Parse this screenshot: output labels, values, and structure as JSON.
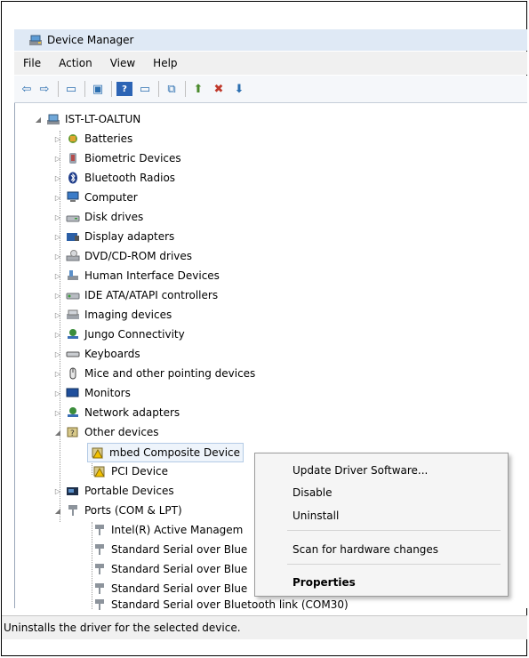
{
  "window": {
    "title": "Device Manager",
    "icon": "computer-management-icon"
  },
  "menu": {
    "items": [
      "File",
      "Action",
      "View",
      "Help"
    ]
  },
  "toolbar": {
    "buttons": [
      "back-icon",
      "forward-icon",
      "properties-icon",
      "refresh-icon",
      "help-icon",
      "show-hidden-icon",
      "scan-hardware-icon",
      "update-driver-icon",
      "uninstall-icon",
      "disable-icon"
    ]
  },
  "tree": {
    "root": "IST-LT-OALTUN",
    "categories": [
      "Batteries",
      "Biometric Devices",
      "Bluetooth Radios",
      "Computer",
      "Disk drives",
      "Display adapters",
      "DVD/CD-ROM drives",
      "Human Interface Devices",
      "IDE ATA/ATAPI controllers",
      "Imaging devices",
      "Jungo Connectivity",
      "Keyboards",
      "Mice and other pointing devices",
      "Monitors",
      "Network adapters"
    ],
    "other": {
      "label": "Other devices",
      "children": [
        "mbed Composite Device",
        "PCI Device"
      ]
    },
    "portable": "Portable Devices",
    "ports": {
      "label": "Ports (COM & LPT)",
      "children": [
        "Intel(R) Active Managem",
        "Standard Serial over Blue",
        "Standard Serial over Blue",
        "Standard Serial over Blue",
        "Standard Serial over Bluetooth link (COM30)"
      ]
    }
  },
  "context_menu": {
    "update": "Update Driver Software...",
    "disable": "Disable",
    "uninstall": "Uninstall",
    "scan": "Scan for hardware changes",
    "properties": "Properties"
  },
  "status": "Uninstalls the driver for the selected device."
}
